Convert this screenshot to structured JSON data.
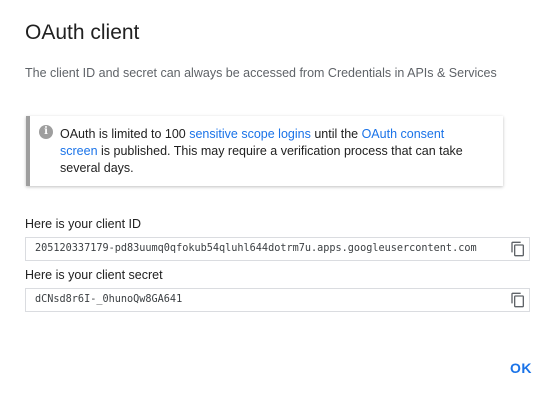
{
  "dialog": {
    "title": "OAuth client",
    "subtitle": "The client ID and secret can always be accessed from Credentials in APIs & Services"
  },
  "notice": {
    "icon": "info-icon",
    "icon_glyph": "i",
    "text_1": "OAuth is limited to 100 ",
    "link_1": "sensitive scope logins",
    "text_2": " until the ",
    "link_2": "OAuth consent screen",
    "text_3": " is published. This may require a verification process that can take several days."
  },
  "client_id": {
    "label": "Here is your client ID",
    "value": "205120337179-pd83uumq0qfokub54qluhl644dotrm7u.apps.googleusercontent.com",
    "copy_icon": "copy-icon"
  },
  "client_secret": {
    "label": "Here is your client secret",
    "value": "dCNsd8r6I-_0hunoQw8GA641",
    "copy_icon": "copy-icon"
  },
  "actions": {
    "ok_label": "OK"
  },
  "colors": {
    "accent": "#1a73e8",
    "notice_border": "#9e9e9e",
    "field_border": "#dadce0"
  }
}
